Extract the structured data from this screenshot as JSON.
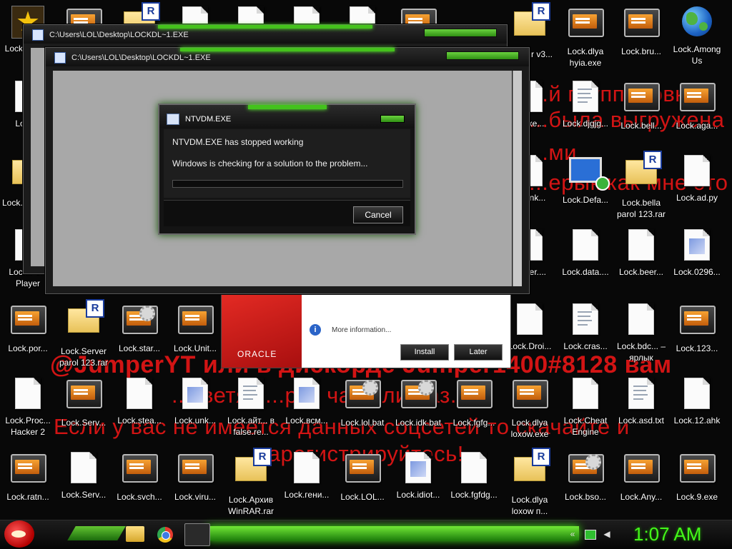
{
  "desktop_icons": [
    {
      "label": "Lock... начи",
      "kind": "star"
    },
    {
      "label": "",
      "kind": "bat"
    },
    {
      "label": "",
      "kind": "rar"
    },
    {
      "label": "",
      "kind": "doc"
    },
    {
      "label": "",
      "kind": "doc"
    },
    {
      "label": "",
      "kind": "doc"
    },
    {
      "label": "",
      "kind": "doc"
    },
    {
      "label": "",
      "kind": "bat"
    },
    {
      "label": "Extr... r v3...",
      "kind": "rar"
    },
    {
      "label": "Lock.dlya hyia.exe",
      "kind": "bat"
    },
    {
      "label": "Lock.bru...",
      "kind": "bat"
    },
    {
      "label": "Lock.Among Us",
      "kind": "globe"
    },
    {
      "label": "Lock...",
      "kind": "doc"
    },
    {
      "label": "...Exe...",
      "kind": "doc"
    },
    {
      "label": "Lock.djgjg...",
      "kind": "txt"
    },
    {
      "label": "Lock.bell...",
      "kind": "bat"
    },
    {
      "label": "Lock.aga...",
      "kind": "bat"
    },
    {
      "label": "Lock... ratni...",
      "kind": "rar"
    },
    {
      "label": "...elink...",
      "kind": "doc"
    },
    {
      "label": "Lock.Defa...",
      "kind": "monitor"
    },
    {
      "label": "Lock.bella parol 123.rar",
      "kind": "rar"
    },
    {
      "label": "Lock.ad.py",
      "kind": "doc"
    },
    {
      "label": "Lock.Po... Player",
      "kind": "doc"
    },
    {
      "label": "...dver....",
      "kind": "doc"
    },
    {
      "label": "Lock.data....",
      "kind": "doc"
    },
    {
      "label": "Lock.beer...",
      "kind": "doc"
    },
    {
      "label": "Lock.0296...",
      "kind": "img"
    },
    {
      "label": "Lock.por...",
      "kind": "bat"
    },
    {
      "label": "Lock.Server parol 123.rar",
      "kind": "rar"
    },
    {
      "label": "Lock.star...",
      "kind": "batgear"
    },
    {
      "label": "Lock.Unit...",
      "kind": "bat"
    },
    {
      "label": "Lock.Droi...",
      "kind": "doc"
    },
    {
      "label": "Lock.cras...",
      "kind": "txt"
    },
    {
      "label": "Lock.bdc... – ярлык",
      "kind": "doc"
    },
    {
      "label": "Lock.123...",
      "kind": "bat"
    },
    {
      "label": "Lock.Proc... Hacker 2",
      "kind": "doc"
    },
    {
      "label": "Lock.Serv...",
      "kind": "bat"
    },
    {
      "label": "Lock.stea...",
      "kind": "doc"
    },
    {
      "label": "Lock.unk...",
      "kind": "img"
    },
    {
      "label": "Lock.айт... в false.re...",
      "kind": "txt"
    },
    {
      "label": "Lock.всм...",
      "kind": "img"
    },
    {
      "label": "Lock.lol.bat",
      "kind": "batgear"
    },
    {
      "label": "Lock.idk.bat",
      "kind": "batgear"
    },
    {
      "label": "Lock.fgfg...",
      "kind": "bat"
    },
    {
      "label": "Lock.dlya loxow.exe",
      "kind": "bat"
    },
    {
      "label": "Lock.Cheat Engine",
      "kind": "doc"
    },
    {
      "label": "Lock.asd.txt",
      "kind": "txt"
    },
    {
      "label": "Lock.12.ahk",
      "kind": "doc"
    },
    {
      "label": "Lock.ratn...",
      "kind": "bat"
    },
    {
      "label": "Lock.Serv...",
      "kind": "doc"
    },
    {
      "label": "Lock.svch...",
      "kind": "bat"
    },
    {
      "label": "Lock.viru...",
      "kind": "bat"
    },
    {
      "label": "Lock.Архив WinRAR.rar",
      "kind": "rar"
    },
    {
      "label": "Lock.гени...",
      "kind": "doc"
    },
    {
      "label": "Lock.LOL...",
      "kind": "bat"
    },
    {
      "label": "Lock.idiot...",
      "kind": "img"
    },
    {
      "label": "Lock.fgfdg...",
      "kind": "doc"
    },
    {
      "label": "Lock.dlya loxow п...",
      "kind": "rar"
    },
    {
      "label": "Lock.bso...",
      "kind": "batgear"
    },
    {
      "label": "Lock.Any...",
      "kind": "bat"
    },
    {
      "label": "Lock.9.exe",
      "kind": "bat"
    }
  ],
  "wallpaper_text": {
    "line1": "...й группировк...",
    "line2": "...была выгружена",
    "line3": "...ми",
    "line4": "...ерык как мне это",
    "line5": "@JumperYT или в дискорде Jumper1400#8128 вам",
    "line6": "...тветят ...рез час или раз...",
    "line7": "Если у вас не имеется данных соцсетей то скачайте и",
    "line8": "зарегистрируйтесь!"
  },
  "windows": {
    "back": {
      "title": "C:\\Users\\LOL\\Desktop\\LOCKDL~1.EXE"
    },
    "front": {
      "title": "C:\\Users\\LOL\\Desktop\\LOCKDL~1.EXE"
    }
  },
  "java_installer": {
    "logo_text": "ORACLE",
    "more_info": "More information...",
    "install_label": "Install",
    "later_label": "Later"
  },
  "ntvdm_dialog": {
    "title": "NTVDM.EXE",
    "message_1": "NTVDM.EXE has stopped working",
    "message_2": "Windows is checking for a solution to the problem...",
    "cancel_label": "Cancel"
  },
  "taskbar": {
    "clock": "1:07 AM",
    "tray_icons": [
      "chevron-icon",
      "network-icon",
      "volume-icon"
    ]
  }
}
